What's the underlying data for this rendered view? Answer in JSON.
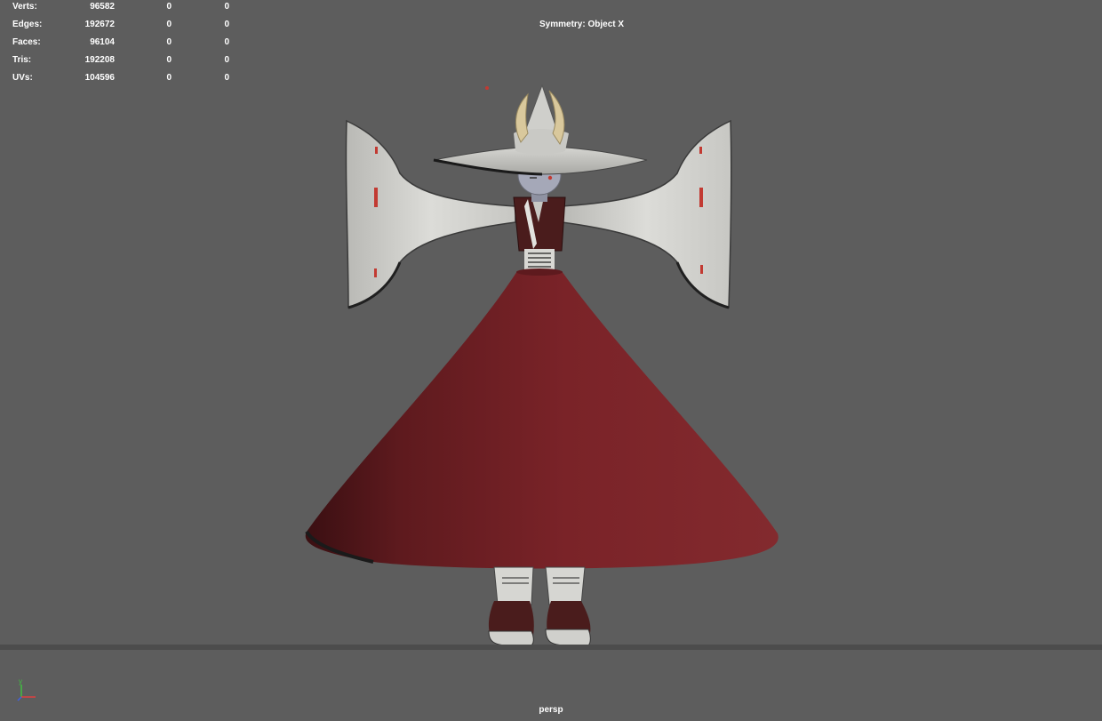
{
  "viewport": {
    "camera": "persp",
    "symmetry": "Symmetry: Object X",
    "background_color": "#5d5d5d"
  },
  "hud": {
    "rows": [
      {
        "label": "Verts:",
        "values": [
          "96582",
          "0",
          "0"
        ]
      },
      {
        "label": "Edges:",
        "values": [
          "192672",
          "0",
          "0"
        ]
      },
      {
        "label": "Faces:",
        "values": [
          "96104",
          "0",
          "0"
        ]
      },
      {
        "label": "Tris:",
        "values": [
          "192208",
          "0",
          "0"
        ]
      },
      {
        "label": "UVs:",
        "values": [
          "104596",
          "0",
          "0"
        ]
      }
    ]
  },
  "axis_gizmo": {
    "y_label": "y",
    "icons": [
      "x-axis-icon",
      "y-axis-icon",
      "z-axis-icon"
    ],
    "colors": {
      "x": "#e04040",
      "y": "#40c040",
      "z": "#4060e0"
    }
  },
  "model": {
    "colors": {
      "skirt": "#7a2328",
      "cloth": "#d8d8d4",
      "vest": "#4a1c1c",
      "horns": "#d9c89c",
      "skin": "#a5a8b8",
      "shoes": "#4a1c1c"
    }
  }
}
